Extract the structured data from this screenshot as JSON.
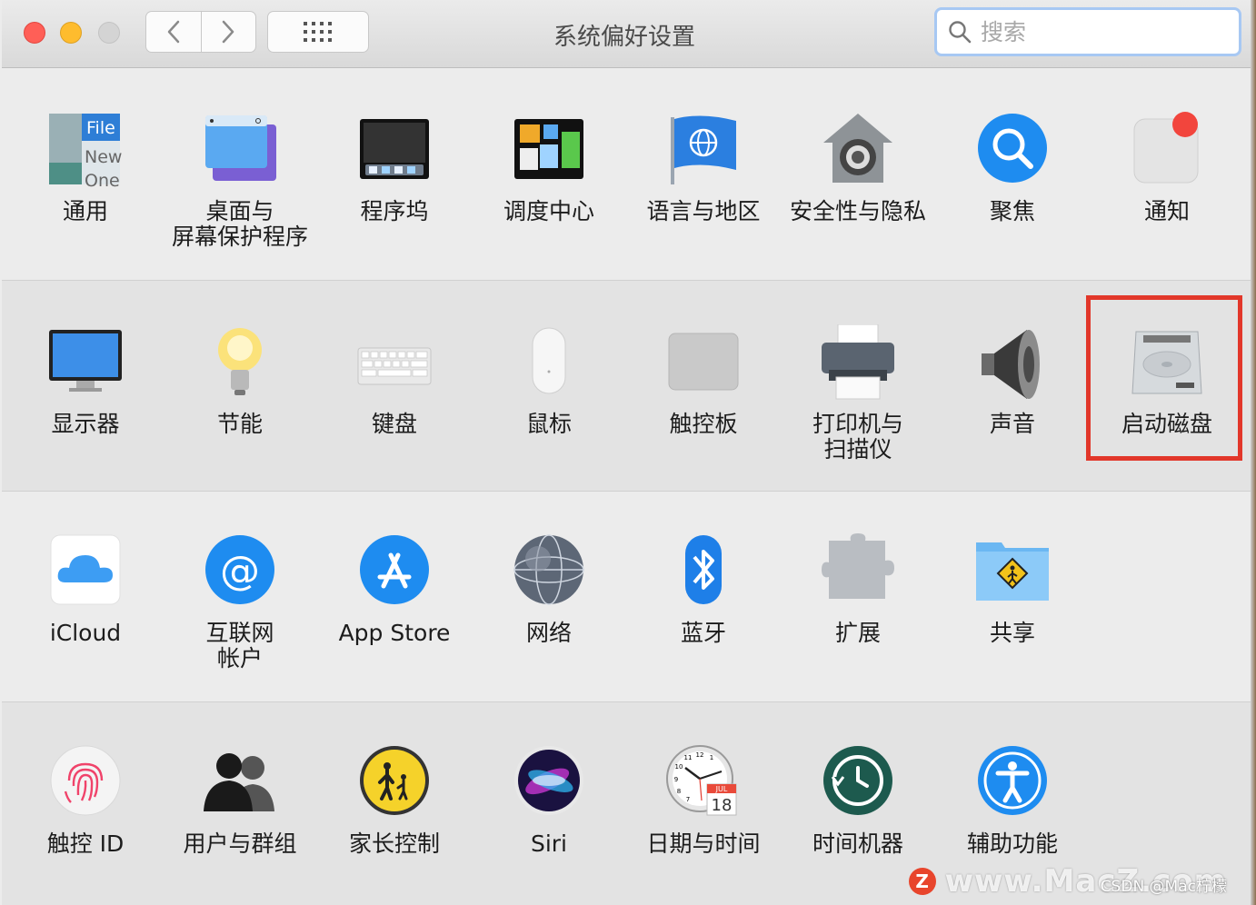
{
  "window": {
    "title": "系统偏好设置",
    "search_placeholder": "搜索"
  },
  "colors": {
    "highlight_border": "#e2372a",
    "close": "#ff5f57",
    "minimize": "#febc2e"
  },
  "rows": [
    [
      {
        "label": "通用",
        "icon": "general-icon"
      },
      {
        "label": "桌面与\n屏幕保护程序",
        "icon": "desktop-screensaver-icon"
      },
      {
        "label": "程序坞",
        "icon": "dock-icon"
      },
      {
        "label": "调度中心",
        "icon": "mission-control-icon"
      },
      {
        "label": "语言与地区",
        "icon": "language-region-icon"
      },
      {
        "label": "安全性与隐私",
        "icon": "security-privacy-icon"
      },
      {
        "label": "聚焦",
        "icon": "spotlight-icon"
      },
      {
        "label": "通知",
        "icon": "notifications-icon"
      }
    ],
    [
      {
        "label": "显示器",
        "icon": "displays-icon"
      },
      {
        "label": "节能",
        "icon": "energy-saver-icon"
      },
      {
        "label": "键盘",
        "icon": "keyboard-icon"
      },
      {
        "label": "鼠标",
        "icon": "mouse-icon"
      },
      {
        "label": "触控板",
        "icon": "trackpad-icon"
      },
      {
        "label": "打印机与\n扫描仪",
        "icon": "printers-scanners-icon"
      },
      {
        "label": "声音",
        "icon": "sound-icon"
      },
      {
        "label": "启动磁盘",
        "icon": "startup-disk-icon"
      }
    ],
    [
      {
        "label": "iCloud",
        "icon": "icloud-icon"
      },
      {
        "label": "互联网\n帐户",
        "icon": "internet-accounts-icon"
      },
      {
        "label": "App Store",
        "icon": "app-store-icon"
      },
      {
        "label": "网络",
        "icon": "network-icon"
      },
      {
        "label": "蓝牙",
        "icon": "bluetooth-icon"
      },
      {
        "label": "扩展",
        "icon": "extensions-icon"
      },
      {
        "label": "共享",
        "icon": "sharing-icon"
      }
    ],
    [
      {
        "label": "触控 ID",
        "icon": "touch-id-icon"
      },
      {
        "label": "用户与群组",
        "icon": "users-groups-icon"
      },
      {
        "label": "家长控制",
        "icon": "parental-controls-icon"
      },
      {
        "label": "Siri",
        "icon": "siri-icon"
      },
      {
        "label": "日期与时间",
        "icon": "date-time-icon"
      },
      {
        "label": "时间机器",
        "icon": "time-machine-icon"
      },
      {
        "label": "辅助功能",
        "icon": "accessibility-icon"
      }
    ]
  ],
  "icon_text": {
    "general_file": "File",
    "general_new": "New",
    "general_one": "One",
    "calendar_month": "JUL",
    "calendar_day": "18",
    "clock_12": "12",
    "clock_11": "11",
    "clock_1": "1",
    "clock_10": "10",
    "clock_9": "9",
    "clock_8": "8",
    "clock_7": "7"
  },
  "watermark": {
    "logo": "Z",
    "site": "www.MacZ.com",
    "csdn": "CSDN @Mac柠檬"
  }
}
